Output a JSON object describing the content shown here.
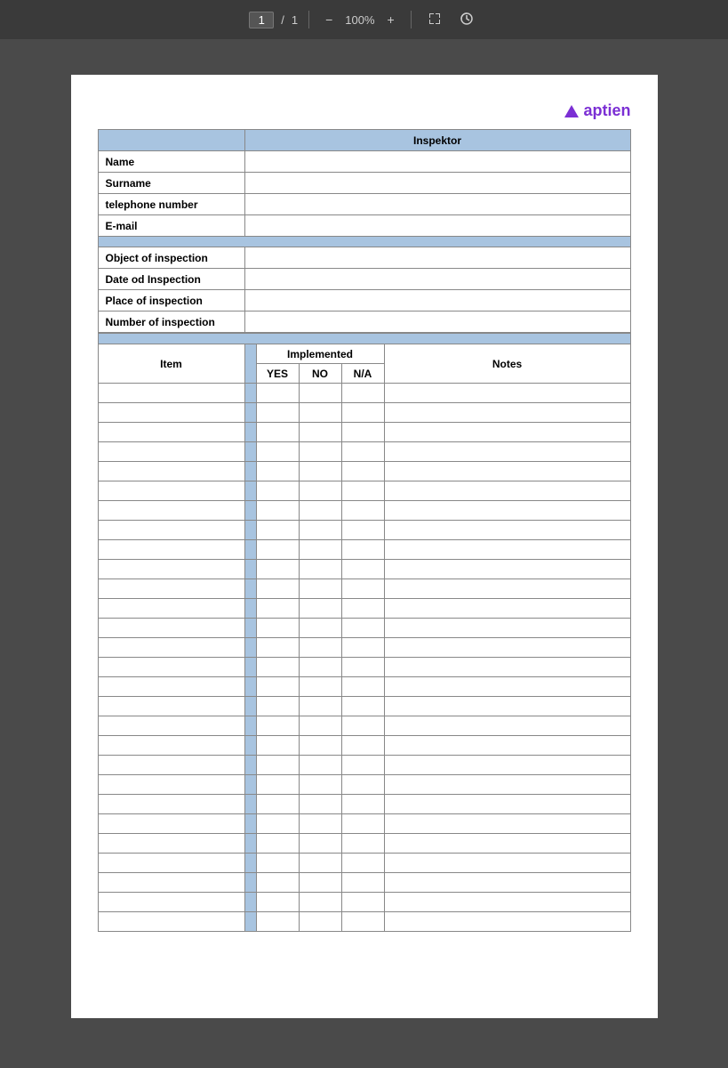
{
  "toolbar": {
    "page_current": "1",
    "page_separator": "/",
    "page_total": "1",
    "zoom": "100%",
    "minus_label": "−",
    "plus_label": "+",
    "fit_icon": "fit",
    "history_icon": "history"
  },
  "logo": {
    "text": "aptien",
    "icon": "triangle"
  },
  "inspector_section": {
    "header": "Inspektor",
    "fields": [
      {
        "label": "Name",
        "value": ""
      },
      {
        "label": "Surname",
        "value": ""
      },
      {
        "label": "telephone number",
        "value": ""
      },
      {
        "label": "E-mail",
        "value": ""
      }
    ]
  },
  "inspection_section": {
    "fields": [
      {
        "label": "Object of inspection",
        "value": ""
      },
      {
        "label": "Date od Inspection",
        "value": ""
      },
      {
        "label": "Place of inspection",
        "value": ""
      },
      {
        "label": "Number of inspection",
        "value": ""
      }
    ]
  },
  "checklist_section": {
    "item_header": "Item",
    "implemented_header": "Implemented",
    "columns": {
      "yes": "YES",
      "no": "NO",
      "na": "N/A",
      "notes": "Notes"
    },
    "rows": 28
  }
}
